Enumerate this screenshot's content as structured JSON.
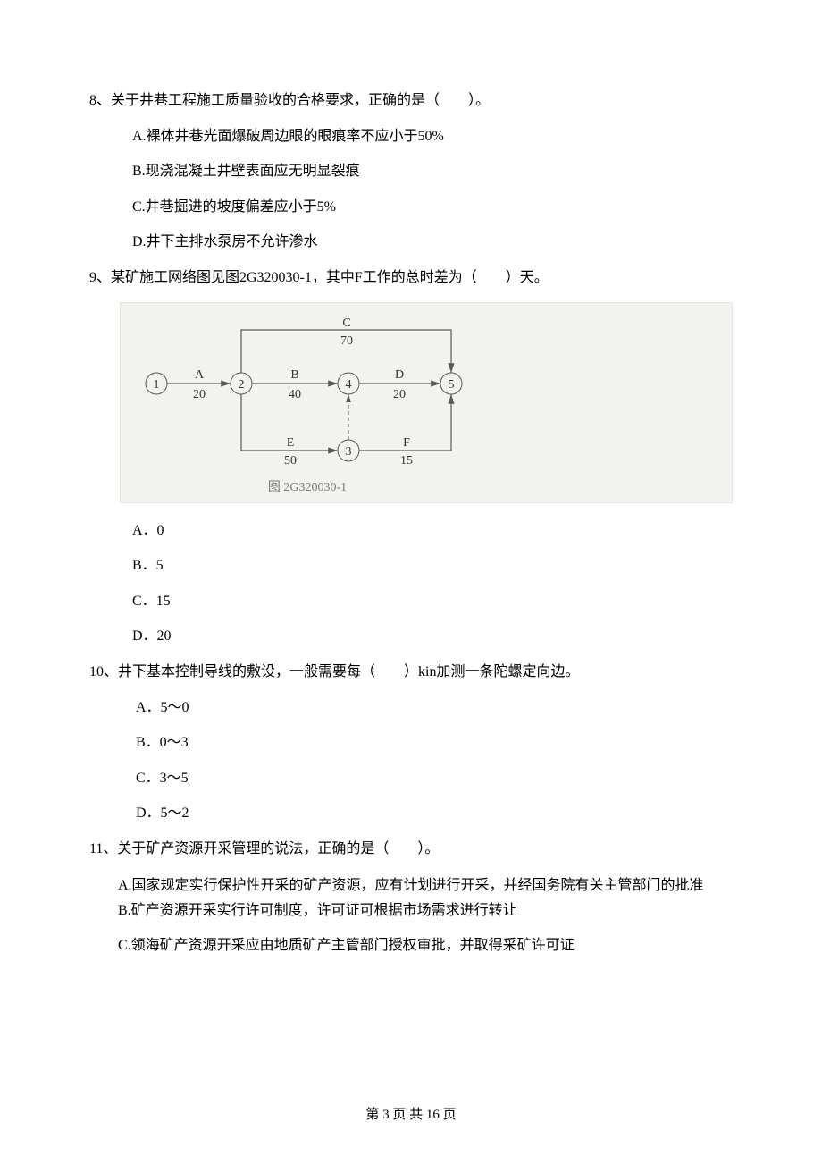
{
  "q8": {
    "stem": "8、关于井巷工程施工质量验收的合格要求，正确的是（　　）。",
    "A": "A.裸体井巷光面爆破周边眼的眼痕率不应小于50%",
    "B": "B.现浇混凝土井壁表面应无明显裂痕",
    "C": "C.井巷掘进的坡度偏差应小于5%",
    "D": "D.井下主排水泵房不允许渗水"
  },
  "q9": {
    "stem": "9、某矿施工网络图见图2G320030-1，其中F工作的总时差为（　　）天。",
    "A": "A．0",
    "B": "B．5",
    "C": "C．15",
    "D": "D．20"
  },
  "q10": {
    "stem": "10、井下基本控制导线的敷设，一般需要每（　　）kin加测一条陀螺定向边。",
    "A": "A．5～0",
    "B": "B．0～3",
    "C": "C．3～5",
    "D": "D．5～2"
  },
  "q11": {
    "stem": "11、关于矿产资源开采管理的说法，正确的是（　　）。",
    "A": "A.国家规定实行保护性开采的矿产资源，应有计划进行开采，并经国务院有关主管部门的批准",
    "B": "B.矿产资源开采实行许可制度，许可证可根据市场需求进行转让",
    "C": "C.领海矿产资源开采应由地质矿产主管部门授权审批，并取得采矿许可证"
  },
  "diagram": {
    "caption": "图 2G320030-1",
    "nodes": {
      "n1": "1",
      "n2": "2",
      "n3": "3",
      "n4": "4",
      "n5": "5"
    },
    "edges": {
      "A_label": "A",
      "A_dur": "20",
      "B_label": "B",
      "B_dur": "40",
      "C_label": "C",
      "C_dur": "70",
      "D_label": "D",
      "D_dur": "20",
      "E_label": "E",
      "E_dur": "50",
      "F_label": "F",
      "F_dur": "15"
    }
  },
  "footer": "第 3 页 共 16 页"
}
